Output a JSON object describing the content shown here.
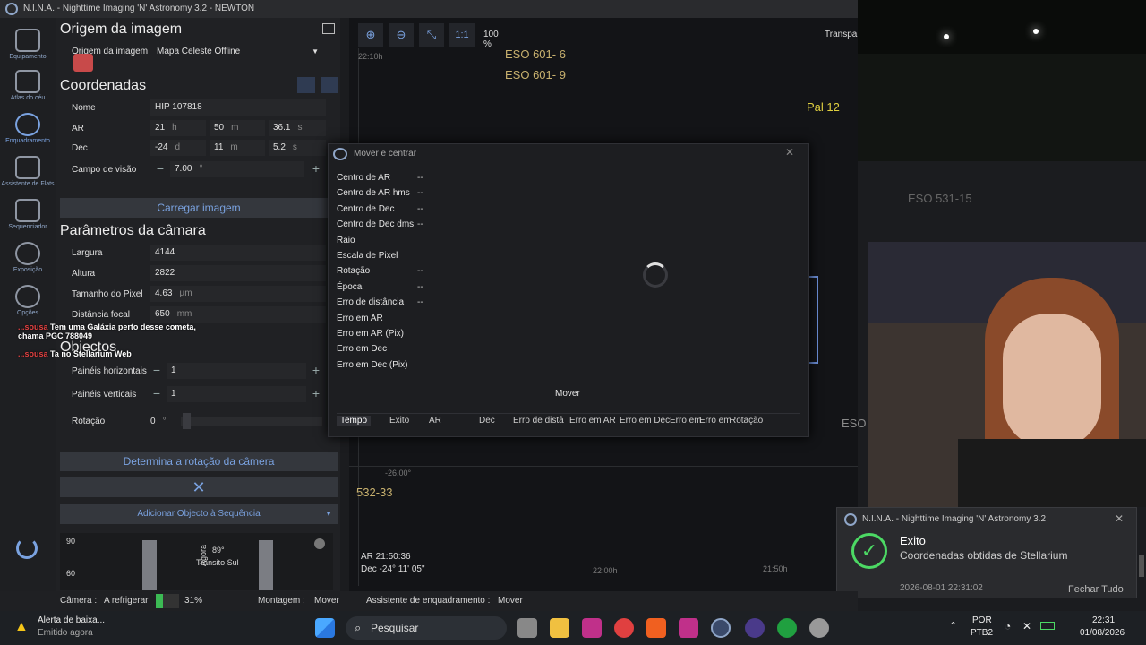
{
  "window": {
    "title": "N.I.N.A. - Nighttime Imaging 'N' Astronomy 3.2   -   NEWTON"
  },
  "sidebar": {
    "items": [
      {
        "label": "Equipamento",
        "icon": "telescope-icon"
      },
      {
        "label": "Atlas do céu",
        "icon": "sky-atlas-icon"
      },
      {
        "label": "Enquadramento",
        "icon": "framing-icon"
      },
      {
        "label": "Assistente de Flats",
        "icon": "flats-icon"
      },
      {
        "label": "Sequenciador",
        "icon": "sequencer-icon"
      },
      {
        "label": "Exposição",
        "icon": "imaging-icon"
      },
      {
        "label": "Opções",
        "icon": "gear-icon"
      }
    ]
  },
  "panel": {
    "image_source_title": "Origem da imagem",
    "image_source_label": "Origem da imagem",
    "image_source_value": "Mapa Celeste Offline",
    "coords_title": "Coordenadas",
    "name_label": "Nome",
    "name_value": "HIP 107818",
    "ra_label": "AR",
    "ra_h": "21",
    "ra_h_unit": "h",
    "ra_m": "50",
    "ra_m_unit": "m",
    "ra_s": "36.1",
    "ra_s_unit": "s",
    "dec_label": "Dec",
    "dec_d": "-24",
    "dec_d_unit": "d",
    "dec_m": "11",
    "dec_m_unit": "m",
    "dec_s": "5.2",
    "dec_s_unit": "s",
    "fov_label": "Campo de visão",
    "fov_value": "7.00",
    "fov_unit": "°",
    "load_image": "Carregar imagem",
    "camera_title": "Parâmetros da câmara",
    "width_label": "Largura",
    "width_value": "4144",
    "height_label": "Altura",
    "height_value": "2822",
    "pixel_label": "Tamanho do Pixel",
    "pixel_value": "4.63",
    "pixel_unit": "µm",
    "focal_label": "Distância focal",
    "focal_value": "650",
    "focal_unit": "mm",
    "objects_title": "Objectos",
    "hpanels_label": "Painéis horizontais",
    "hpanels_value": "1",
    "vpanels_label": "Painéis verticais",
    "vpanels_value": "1",
    "rotation_label": "Rotação",
    "rotation_value": "0",
    "rotation_unit": "°",
    "determine_rotation": "Determina a rotação da câmera",
    "add_to_sequence": "Adicionar Objecto à Sequência",
    "alt_chart": {
      "y_ticks": [
        "90",
        "60"
      ],
      "now_label": "Agora",
      "transit_label": "89°",
      "transit_text": "Trânsito Sul"
    }
  },
  "chat": [
    {
      "user": "...sousa",
      "text": "Tem uma Galáxia perto desse cometa, chama PGC 788049"
    },
    {
      "user": "...sousa",
      "text": "Ta no Stellarium Web"
    }
  ],
  "sky": {
    "toolbar": {
      "one_to_one": "1:1",
      "zoom": "100 %",
      "transparency": "Transpar"
    },
    "labels": [
      "ESO 601- 6",
      "ESO 601- 9",
      "Pal 12",
      "ESO",
      "532-33",
      "ESO 531-15"
    ],
    "grid_labels": [
      "22:10h",
      "-26.00°",
      "22:00h",
      "21:50h"
    ],
    "center_ra": "AR 21:50:36",
    "center_dec": "Dec -24° 11' 05\""
  },
  "dialog": {
    "title": "Mover e centrar",
    "rows": [
      {
        "label": "Centro de AR",
        "value": "--"
      },
      {
        "label": "Centro de AR hms",
        "value": "--"
      },
      {
        "label": "Centro de Dec",
        "value": "--"
      },
      {
        "label": "Centro de Dec dms",
        "value": "--"
      },
      {
        "label": "Raio",
        "value": ""
      },
      {
        "label": "Escala de Pixel",
        "value": ""
      },
      {
        "label": "Rotação",
        "value": "--"
      },
      {
        "label": "Época",
        "value": "--"
      },
      {
        "label": "Erro de distância",
        "value": "--"
      },
      {
        "label": "Erro em AR",
        "value": ""
      },
      {
        "label": "Erro em AR (Pix)",
        "value": ""
      },
      {
        "label": "Erro em Dec",
        "value": ""
      },
      {
        "label": "Erro em Dec (Pix)",
        "value": ""
      }
    ],
    "move_button": "Mover",
    "columns": [
      "Tempo",
      "Exito",
      "AR",
      "Dec",
      "Erro de distâ",
      "Erro em AR",
      "Erro em Dec",
      "Erro em",
      "Erro em",
      "Rotação"
    ]
  },
  "toast": {
    "app": "N.I.N.A. - Nighttime Imaging 'N' Astronomy 3.2",
    "title": "Exito",
    "message": "Coordenadas obtidas de Stellarium",
    "timestamp": "2026-08-01 22:31:02",
    "close_all": "Fechar Tudo"
  },
  "statusbar": {
    "camera_label": "Câmera :",
    "camera_status": "A refrigerar",
    "camera_progress": 31,
    "camera_progress_text": "31%",
    "mount_label": "Montagem :",
    "mount_status": "Mover",
    "framing_label": "Assistente de enquadramento :",
    "framing_status": "Mover"
  },
  "taskbar": {
    "alert_title": "Alerta de baixa...",
    "alert_sub": "Emitido agora",
    "search": "Pesquisar",
    "lang1": "POR",
    "lang2": "PTB2",
    "time": "22:31",
    "date": "01/08/2026"
  },
  "colors": {
    "accent": "#7aa2e0",
    "success": "#4cd964",
    "progress": "#3cba54"
  }
}
